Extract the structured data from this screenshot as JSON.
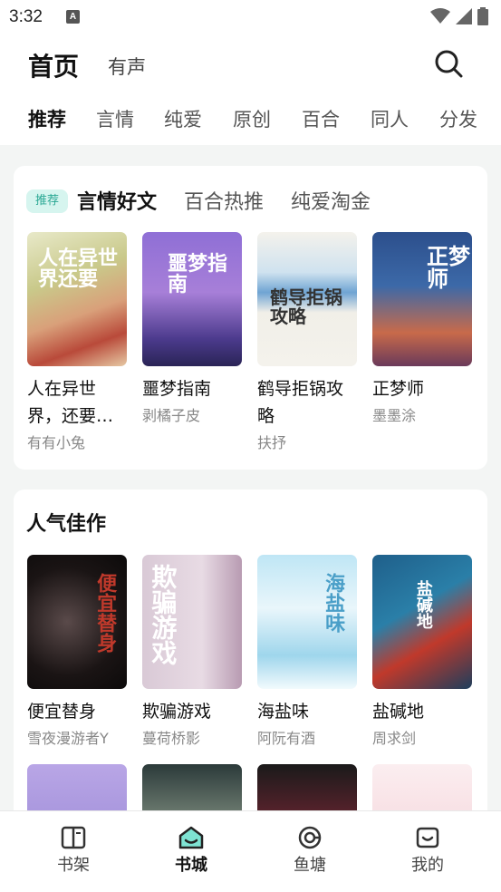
{
  "status_bar": {
    "time": "3:32",
    "notification_glyph": "A"
  },
  "header": {
    "home_label": "首页",
    "audio_label": "有声"
  },
  "tabs": [
    {
      "label": "推荐",
      "active": true
    },
    {
      "label": "言情"
    },
    {
      "label": "纯爱"
    },
    {
      "label": "原创"
    },
    {
      "label": "百合"
    },
    {
      "label": "同人"
    },
    {
      "label": "分发"
    }
  ],
  "featured": {
    "badge": "推荐",
    "subtabs": [
      {
        "label": "言情好文",
        "active": true
      },
      {
        "label": "百合热推"
      },
      {
        "label": "纯爱淘金"
      }
    ],
    "books": [
      {
        "title": "人在异世界，还要…",
        "author": "有有小兔",
        "cover_text": "人在异世界还要"
      },
      {
        "title": "噩梦指南",
        "author": "剥橘子皮",
        "cover_text": "噩梦指南"
      },
      {
        "title": "鹤导拒锅攻略",
        "author": "扶抒",
        "cover_text": "鹤导拒锅攻略"
      },
      {
        "title": "正梦师",
        "author": "墨墨涂",
        "cover_text": "正梦师"
      }
    ]
  },
  "popular": {
    "title": "人气佳作",
    "books": [
      {
        "title": "便宜替身",
        "author": "雪夜漫游者Y",
        "cover_text": "便宜替身"
      },
      {
        "title": "欺骗游戏",
        "author": "蔓荷桥影",
        "cover_text": "欺骗游戏"
      },
      {
        "title": "海盐味",
        "author": "阿阮有酒",
        "cover_text": "海盐味"
      },
      {
        "title": "盐碱地",
        "author": "周求剑",
        "cover_text": "盐碱地"
      }
    ]
  },
  "bottom_nav": [
    {
      "label": "书架",
      "icon": "bookshelf-icon"
    },
    {
      "label": "书城",
      "icon": "bookstore-icon",
      "active": true
    },
    {
      "label": "鱼塘",
      "icon": "fishpond-icon"
    },
    {
      "label": "我的",
      "icon": "profile-icon"
    }
  ],
  "colors": {
    "accent": "#7ee3d3",
    "badge_bg": "#d6f5ef",
    "badge_text": "#2aa894"
  }
}
